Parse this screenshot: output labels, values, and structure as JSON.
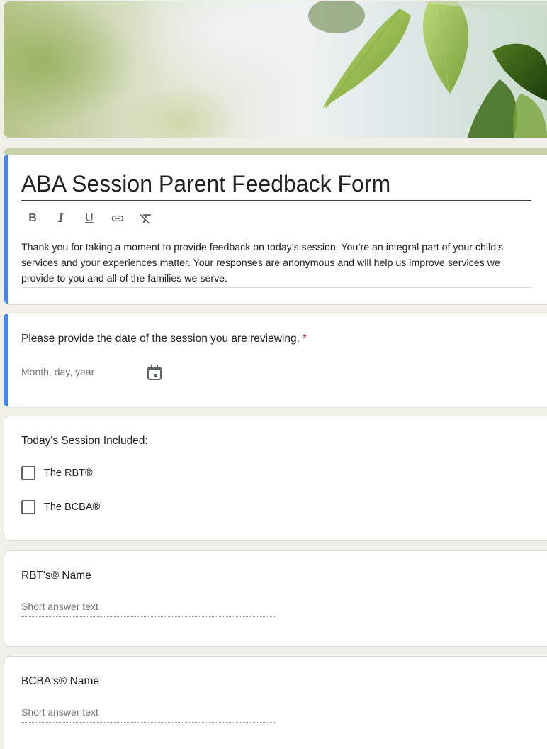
{
  "form": {
    "title": "ABA Session Parent Feedback Form",
    "description": "Thank you for taking a moment to provide feedback on today’s session. You’re an integral part of your child’s services and your experiences matter. Your responses are anonymous and will help us improve services we provide to you and all of the families we serve.",
    "theme_accent": "#4285f4",
    "header_strip_color": "#c8d0a8"
  },
  "toolbar": {
    "bold": "B",
    "italic": "I",
    "underline": "U",
    "link_icon": "link-icon",
    "clear_format_icon": "clear-formatting-icon"
  },
  "questions": {
    "date": {
      "title": "Please provide the date of the session you are reviewing.",
      "required_mark": "*",
      "placeholder": "Month, day, year",
      "icon": "calendar-icon"
    },
    "session_included": {
      "title": "Today's Session Included:",
      "options": [
        {
          "label": "The RBT®",
          "checked": false
        },
        {
          "label": "The BCBA®",
          "checked": false
        }
      ]
    },
    "rbt_name": {
      "title": "RBT's® Name",
      "placeholder": "Short answer text"
    },
    "bcba_name": {
      "title": "BCBA's® Name",
      "placeholder": "Short answer text"
    }
  }
}
